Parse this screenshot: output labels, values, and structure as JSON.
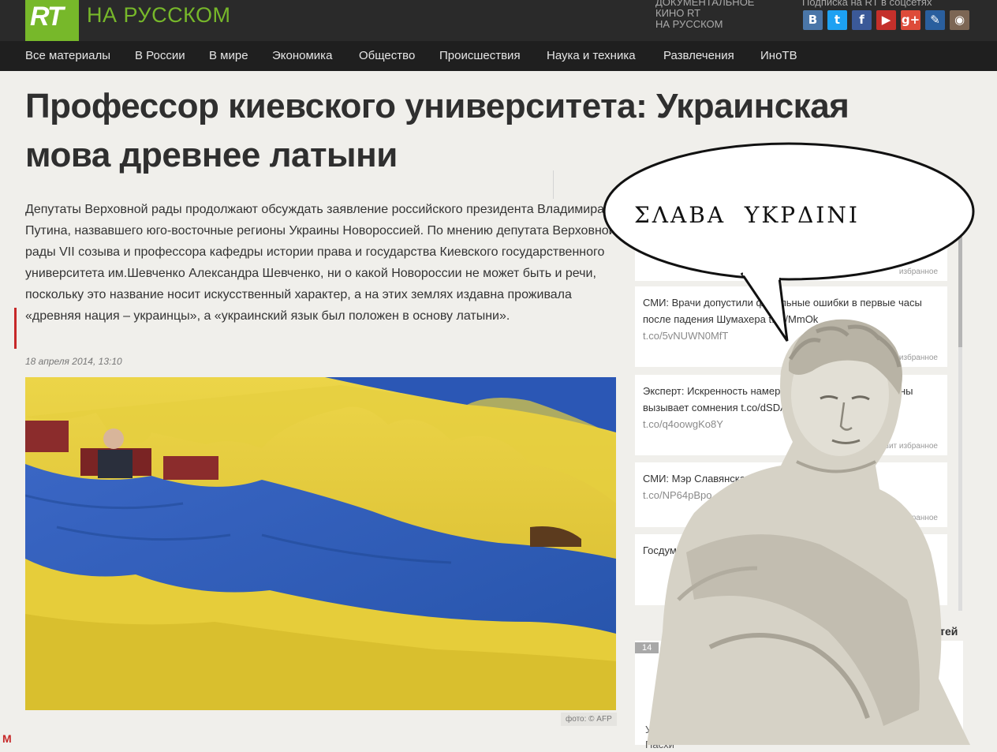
{
  "header": {
    "logo_mark": "RT",
    "logo_text": "НА РУССКОМ",
    "doc_line1": "ДОКУМЕНТАЛЬНОЕ",
    "doc_line2": "КИНО RT",
    "doc_line3": "НА РУССКОМ",
    "social_label": "Подписка на RT в соцсетях",
    "socials": [
      {
        "icon": "vk-icon",
        "glyph": "B",
        "color": "#4a76a8"
      },
      {
        "icon": "twitter-icon",
        "glyph": "t",
        "color": "#1da1f2"
      },
      {
        "icon": "facebook-icon",
        "glyph": "f",
        "color": "#3b5998"
      },
      {
        "icon": "youtube-icon",
        "glyph": "▶",
        "color": "#c4302b"
      },
      {
        "icon": "google-plus-icon",
        "glyph": "g+",
        "color": "#dd4b39"
      },
      {
        "icon": "livejournal-icon",
        "glyph": "✎",
        "color": "#2a5f9e"
      },
      {
        "icon": "instagram-icon",
        "glyph": "◉",
        "color": "#7c6654"
      }
    ]
  },
  "nav": [
    "Все материалы",
    "В России",
    "В мире",
    "Экономика",
    "Общество",
    "Происшествия",
    "Наука и техника",
    "Развлечения",
    "ИноТВ"
  ],
  "article": {
    "title": "Профессор киевского университета: Украинская мова древнее латыни",
    "lead": "Депутаты Верховной рады продолжают обсуждать заявление российского президента Владимира Путина, назвавшего юго-восточные регионы Украины Новороссией. По мнению депутата Верховной рады VII созыва и профессора кафедры истории права и государства Киевского государственного университета им.Шевченко Александра Шевченко, ни о какой Новороссии не может быть и речи, поскольку это название носит искусственный характер, а на этих землях издавна проживала «древняя нация – украинцы», а «украинский язык был положен в основу латыни».",
    "date": "18 апреля 2014, 13:10",
    "photo_credit": "фото: © AFP",
    "bottom_letter": "М"
  },
  "feed": [
    {
      "text": "",
      "link": "",
      "meta": "избранное"
    },
    {
      "text": "СМИ: Врачи допустили фатальные ошибки в первые часы после падения Шумахера t.co/MmOk",
      "link": "t.co/5vNUWN0MfT",
      "meta": "9 минут   ретвит   избранное"
    },
    {
      "text": "Эксперт: Искренность намерений новой власти Украины вызывает сомнения t.co/dSDAp",
      "link": "t.co/q4oowgKo8Y",
      "meta": "16 минут   ретвит   избранное"
    },
    {
      "text": "СМИ: Мэр Славянска Неля Штепа задержана",
      "link": "t.co/NP64pBpo",
      "meta": "ретвит   избранное"
    },
    {
      "text": "Госдума приняла закон о регистрации блогеров к СМИ",
      "link": "",
      "meta": "избранное"
    }
  ],
  "section": {
    "heading": "овостей",
    "number": "14",
    "text": "Украина минимизирует ограничения на въезд из России за Пасхи"
  },
  "overlay": {
    "speech": "ΣΛΑΒΑ  ΥΚΡΔΙΝΙ"
  }
}
